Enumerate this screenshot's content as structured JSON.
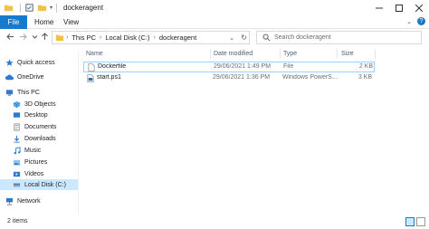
{
  "window": {
    "title": "dockeragent",
    "controls": [
      "minimize",
      "maximize",
      "close"
    ]
  },
  "ribbon": {
    "tabs": [
      "File",
      "Home",
      "View"
    ]
  },
  "address_bar": {
    "crumbs": [
      "This PC",
      "Local Disk (C:)",
      "dockeragent"
    ]
  },
  "search": {
    "placeholder": "Search dockeragent"
  },
  "sidebar": {
    "items": [
      {
        "label": "Quick access",
        "icon": "star-icon"
      },
      {
        "label": "OneDrive",
        "icon": "cloud-icon"
      },
      {
        "label": "This PC",
        "icon": "computer-icon"
      },
      {
        "label": "3D Objects",
        "icon": "cube-icon"
      },
      {
        "label": "Desktop",
        "icon": "desktop-icon"
      },
      {
        "label": "Documents",
        "icon": "documents-icon"
      },
      {
        "label": "Downloads",
        "icon": "download-icon"
      },
      {
        "label": "Music",
        "icon": "music-icon"
      },
      {
        "label": "Pictures",
        "icon": "pictures-icon"
      },
      {
        "label": "Videos",
        "icon": "videos-icon"
      },
      {
        "label": "Local Disk (C:)",
        "icon": "drive-icon",
        "selected": true
      },
      {
        "label": "Network",
        "icon": "network-icon"
      }
    ]
  },
  "file_list": {
    "columns": [
      "Name",
      "Date modified",
      "Type",
      "Size"
    ],
    "rows": [
      {
        "name": "Dockerfile",
        "date": "29/06/2021 1:49 PM",
        "type": "File",
        "size": "2 KB",
        "icon": "file-icon"
      },
      {
        "name": "start.ps1",
        "date": "29/06/2021 1:36 PM",
        "type": "Windows PowerS...",
        "size": "3 KB",
        "icon": "powershell-icon"
      }
    ]
  },
  "status": {
    "items_count": "2 items"
  },
  "colors": {
    "accent": "#1979ca",
    "selection": "#cce8ff",
    "folder": "#f3c14a"
  }
}
